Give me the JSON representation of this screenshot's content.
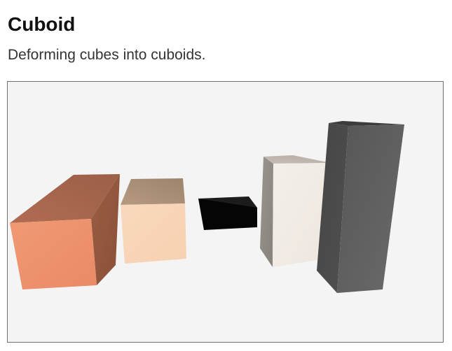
{
  "header": {
    "title": "Cuboid",
    "subtitle": "Deforming cubes into cuboids."
  },
  "scene": {
    "background_color": "#f4f4f4",
    "border_color": "#6f6f6f",
    "cuboids": [
      {
        "name": "salmon-cuboid",
        "front": "#eb9470",
        "top": "#a86650",
        "side": "#93583f"
      },
      {
        "name": "peach-cuboid",
        "front": "#f8d6b8",
        "top": "#a88c74",
        "side": "#d8b89a"
      },
      {
        "name": "black-cuboid",
        "front": "#050505",
        "top": "#1e1e1e",
        "side": "#111111"
      },
      {
        "name": "cream-cuboid",
        "front": "#f1ece6",
        "top": "#bfb7ad",
        "side": "#8f8a85"
      },
      {
        "name": "charcoal-cuboid",
        "front": "#5e5e5e",
        "top": "#3f3f3f",
        "side": "#4b4b4b"
      }
    ]
  }
}
